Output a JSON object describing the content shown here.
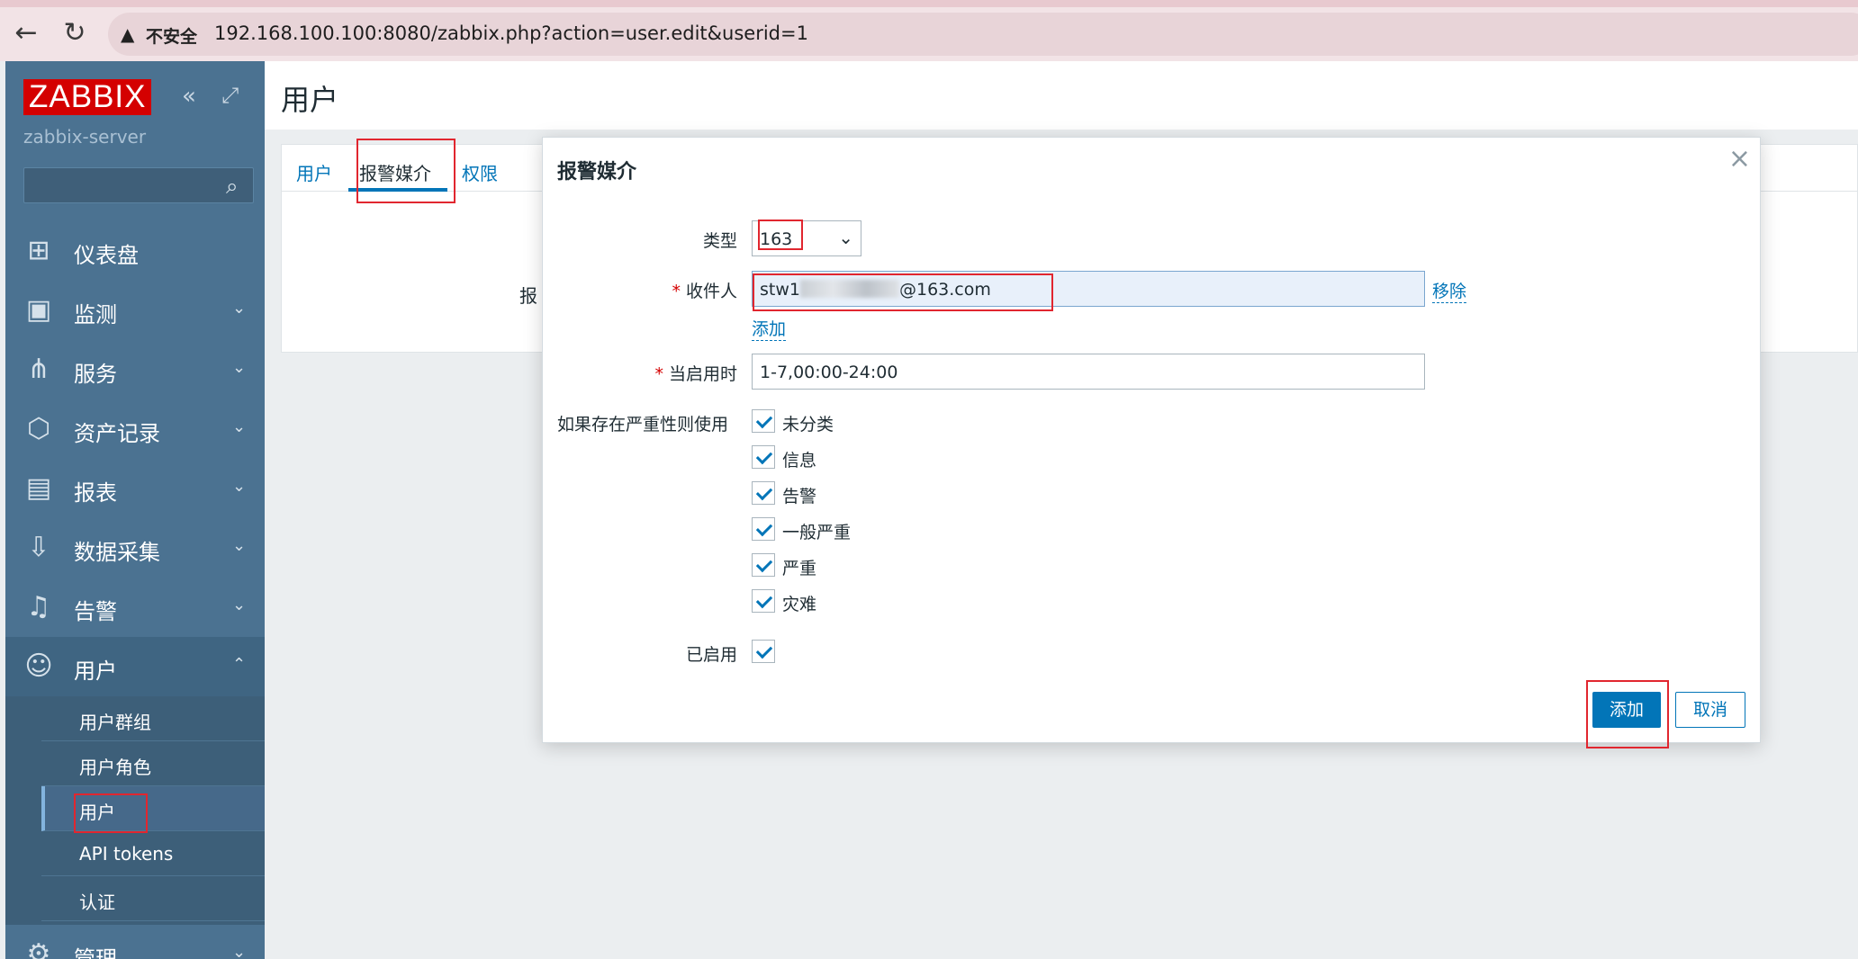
{
  "browser": {
    "back_icon": "←",
    "reload_icon": "↻",
    "insecure_label": "不安全",
    "url": "192.168.100.100:8080/zabbix.php?action=user.edit&userid=1"
  },
  "sidebar": {
    "logo": "ZABBIX",
    "server_name": "zabbix-server",
    "search_placeholder": "",
    "items": [
      {
        "label": "仪表盘",
        "icon": "dashboard-icon"
      },
      {
        "label": "监测",
        "icon": "monitoring-icon"
      },
      {
        "label": "服务",
        "icon": "services-icon"
      },
      {
        "label": "资产记录",
        "icon": "inventory-icon"
      },
      {
        "label": "报表",
        "icon": "reports-icon"
      },
      {
        "label": "数据采集",
        "icon": "data-collection-icon"
      },
      {
        "label": "告警",
        "icon": "alerts-icon"
      },
      {
        "label": "用户",
        "icon": "users-icon"
      },
      {
        "label": "管理",
        "icon": "administration-icon"
      }
    ],
    "sub_items": [
      {
        "label": "用户群组"
      },
      {
        "label": "用户角色"
      },
      {
        "label": "用户"
      },
      {
        "label": "API tokens"
      },
      {
        "label": "认证"
      }
    ]
  },
  "page": {
    "title": "用户",
    "tabs": [
      {
        "label": "用户"
      },
      {
        "label": "报警媒介"
      },
      {
        "label": "权限"
      }
    ],
    "background_label": "报"
  },
  "modal": {
    "title": "报警媒介",
    "close_icon": "×",
    "type_label": "类型",
    "type_value": "163",
    "recipient_label": "收件人",
    "recipient_prefix": "stw1",
    "recipient_suffix": "@163.com",
    "remove_label": "移除",
    "add_link_label": "添加",
    "when_active_label": "当启用时",
    "when_active_value": "1-7,00:00-24:00",
    "severity_label": "如果存在严重性则使用",
    "severities": [
      {
        "label": "未分类",
        "checked": true
      },
      {
        "label": "信息",
        "checked": true
      },
      {
        "label": "告警",
        "checked": true
      },
      {
        "label": "一般严重",
        "checked": true
      },
      {
        "label": "严重",
        "checked": true
      },
      {
        "label": "灾难",
        "checked": true
      }
    ],
    "enabled_label": "已启用",
    "enabled": true,
    "add_button": "添加",
    "cancel_button": "取消"
  },
  "colors": {
    "sidebar": "#4b7291",
    "accent": "#0275b8",
    "logo": "#d40000",
    "highlight": "#e1262f"
  }
}
